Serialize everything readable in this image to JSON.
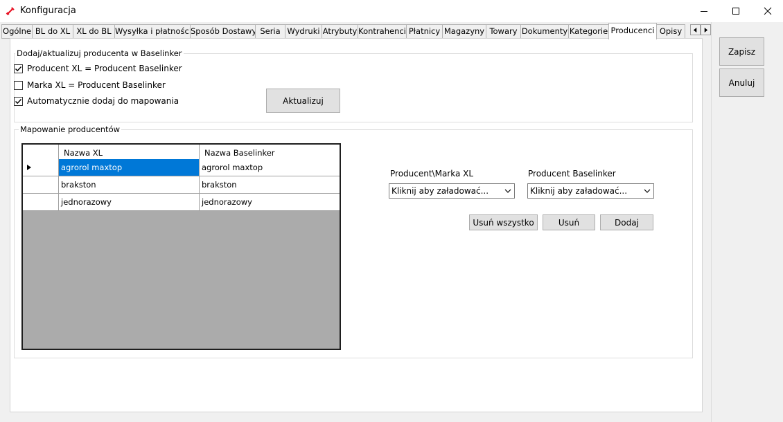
{
  "window": {
    "title": "Konfiguracja",
    "app_icon": "wrench-icon"
  },
  "tabs": [
    {
      "label": "Ogólne"
    },
    {
      "label": "BL do XL"
    },
    {
      "label": "XL do BL"
    },
    {
      "label": "Wysyłka i płatności"
    },
    {
      "label": "Sposób Dostawy"
    },
    {
      "label": "Seria"
    },
    {
      "label": "Wydruki"
    },
    {
      "label": "Atrybuty"
    },
    {
      "label": "Kontrahenci"
    },
    {
      "label": "Płatnicy"
    },
    {
      "label": "Magazyny"
    },
    {
      "label": "Towary"
    },
    {
      "label": "Dokumenty"
    },
    {
      "label": "Kategorie"
    },
    {
      "label": "Producenci"
    },
    {
      "label": "Opisy"
    }
  ],
  "active_tab": "Producenci",
  "update_group": {
    "title": "Dodaj/aktualizuj producenta w Baselinker",
    "options": [
      {
        "label": "Producent XL = Producent Baselinker",
        "checked": true
      },
      {
        "label": "Marka XL = Producent Baselinker",
        "checked": false
      },
      {
        "label": "Automatycznie dodaj do mapowania",
        "checked": true
      }
    ],
    "update_button": "Aktualizuj"
  },
  "mapping_group": {
    "title": "Mapowanie producentów",
    "columns": [
      "Nazwa XL",
      "Nazwa Baselinker"
    ],
    "rows": [
      {
        "xl": "agrorol maxtop",
        "baselinker": "agrorol maxtop",
        "selected": true
      },
      {
        "xl": "brakston",
        "baselinker": "brakston",
        "selected": false
      },
      {
        "xl": "jednorazowy",
        "baselinker": "jednorazowy",
        "selected": false
      }
    ],
    "producer_xl_label": "Producent\\Marka XL",
    "producer_xl_value": "Kliknij aby załadować...",
    "producer_bl_label": "Producent Baselinker",
    "producer_bl_value": "Kliknij aby załadować...",
    "remove_all_button": "Usuń wszystko",
    "remove_button": "Usuń",
    "add_button": "Dodaj"
  },
  "side_buttons": {
    "save": "Zapisz",
    "cancel": "Anuluj"
  },
  "colors": {
    "accent": "#0078d7",
    "icon_red": "#e81123"
  }
}
